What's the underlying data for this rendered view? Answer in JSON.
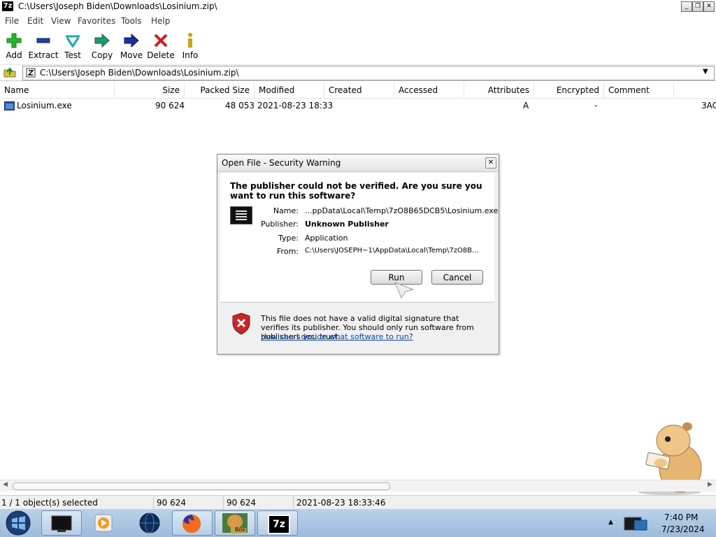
{
  "window": {
    "title": "C:\\Users\\Joseph Biden\\Downloads\\Losinium.zip\\",
    "logo": "7z"
  },
  "menu": [
    "File",
    "Edit",
    "View",
    "Favorites",
    "Tools",
    "Help"
  ],
  "toolbar": {
    "items": [
      {
        "label": "Add",
        "icon": "plus-icon"
      },
      {
        "label": "Extract",
        "icon": "minus-icon"
      },
      {
        "label": "Test",
        "icon": "check-icon"
      },
      {
        "label": "Copy",
        "icon": "copy-arrow-icon"
      },
      {
        "label": "Move",
        "icon": "move-arrow-icon"
      },
      {
        "label": "Delete",
        "icon": "x-icon"
      },
      {
        "label": "Info",
        "icon": "info-icon"
      }
    ]
  },
  "address": {
    "path": "C:\\Users\\Joseph Biden\\Downloads\\Losinium.zip\\"
  },
  "columns": [
    "Name",
    "Size",
    "Packed Size",
    "Modified",
    "Created",
    "Accessed",
    "Attributes",
    "Encrypted",
    "Comment"
  ],
  "files": [
    {
      "name": "Losinium.exe",
      "size": "90 624",
      "packed": "48 053",
      "modified": "2021-08-23 18:33",
      "created": "",
      "accessed": "",
      "attributes": "A",
      "encrypted": "-",
      "comment": "",
      "extra": "3AC"
    }
  ],
  "dialog": {
    "title": "Open File - Security Warning",
    "question": "The publisher could not be verified.  Are you sure you want to run this software?",
    "fields": [
      {
        "label": "Name:",
        "value": "...ppData\\Local\\Temp\\7zO8B65DCB5\\Losinium.exe"
      },
      {
        "label": "Publisher:",
        "value": "Unknown Publisher"
      },
      {
        "label": "Type:",
        "value": "Application"
      },
      {
        "label": "From:",
        "value": "C:\\Users\\JOSEPH~1\\AppData\\Local\\Temp\\7zO8B..."
      }
    ],
    "run_label": "Run",
    "cancel_label": "Cancel",
    "footer_text": "This file does not have a valid digital signature that verifies its publisher.  You should only run software from publishers you trust.",
    "footer_link": "How can I decide what software to run?"
  },
  "status": {
    "selected": "1 / 1 object(s) selected",
    "size": "90 624",
    "packed": "90 624",
    "modified": "2021-08-23 18:33:46"
  },
  "taskbar": {
    "time": "7:40 PM",
    "date": "7/23/2024",
    "box_label": "Box",
    "zip_label": "7z"
  }
}
